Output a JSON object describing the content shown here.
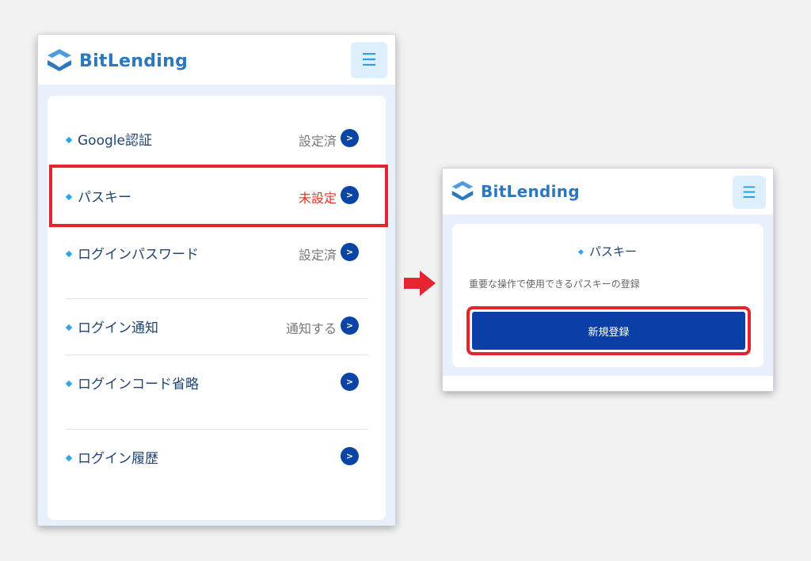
{
  "brand": {
    "name": "BitLending",
    "logo_icon": "bitlending-logo-icon",
    "color": "#2c78bf"
  },
  "menu_icon": "☰",
  "settings_list": [
    {
      "label": "Google認証",
      "value": "設定済"
    },
    {
      "label": "パスキー",
      "value": "未設定",
      "status": "warning"
    },
    {
      "label": "ログインパスワード",
      "value": "設定済"
    },
    {
      "label": "ログイン通知",
      "value": "通知する"
    },
    {
      "label": "ログインコード省略",
      "value": ""
    },
    {
      "label": "ログイン履歴",
      "value": ""
    }
  ],
  "passkey_panel": {
    "title": "パスキー",
    "description": "重要な操作で使用できるパスキーの登録",
    "register_button": "新規登録"
  },
  "colors": {
    "accent": "#0a3fa6",
    "highlight": "#e4242e",
    "warning_text": "#e0332c",
    "bullet": "#2fa6e6"
  }
}
